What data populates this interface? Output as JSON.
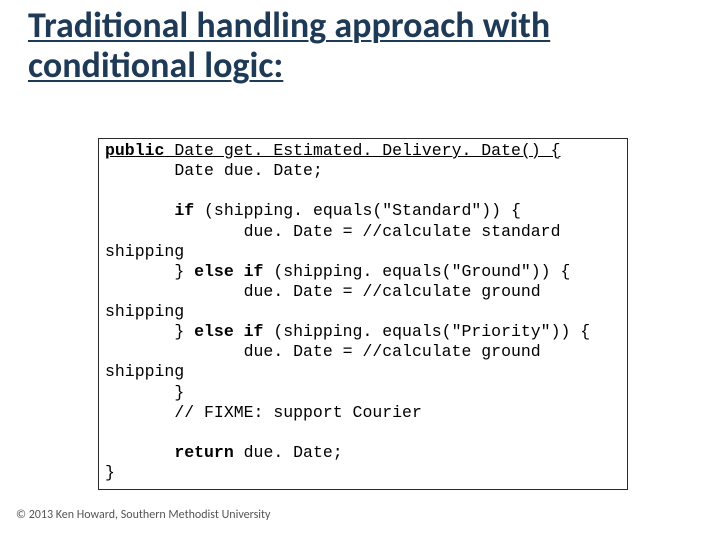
{
  "title": "Traditional handling approach with conditional logic:",
  "code": {
    "sig_kw": "public",
    "sig_rest": " Date get. Estimated. Delivery. Date() {",
    "l2": "       Date due. Date;",
    "blank": "",
    "l3a": "       ",
    "l3kw": "if",
    "l3b": " (shipping. equals(\"Standard\")) {",
    "l4": "              due. Date = //calculate standard shipping",
    "l5a": "       } ",
    "l5kw": "else if",
    "l5b": " (shipping. equals(\"Ground\")) {",
    "l6": "              due. Date = //calculate ground shipping",
    "l7a": "       } ",
    "l7kw": "else if",
    "l7b": " (shipping. equals(\"Priority\")) {",
    "l8": "              due. Date = //calculate ground shipping",
    "l9": "       }",
    "l10": "       // FIXME: support Courier",
    "l11a": "       ",
    "l11kw": "return",
    "l11b": " due. Date;",
    "l12": "}"
  },
  "footer": "© 2013 Ken Howard, Southern Methodist University"
}
